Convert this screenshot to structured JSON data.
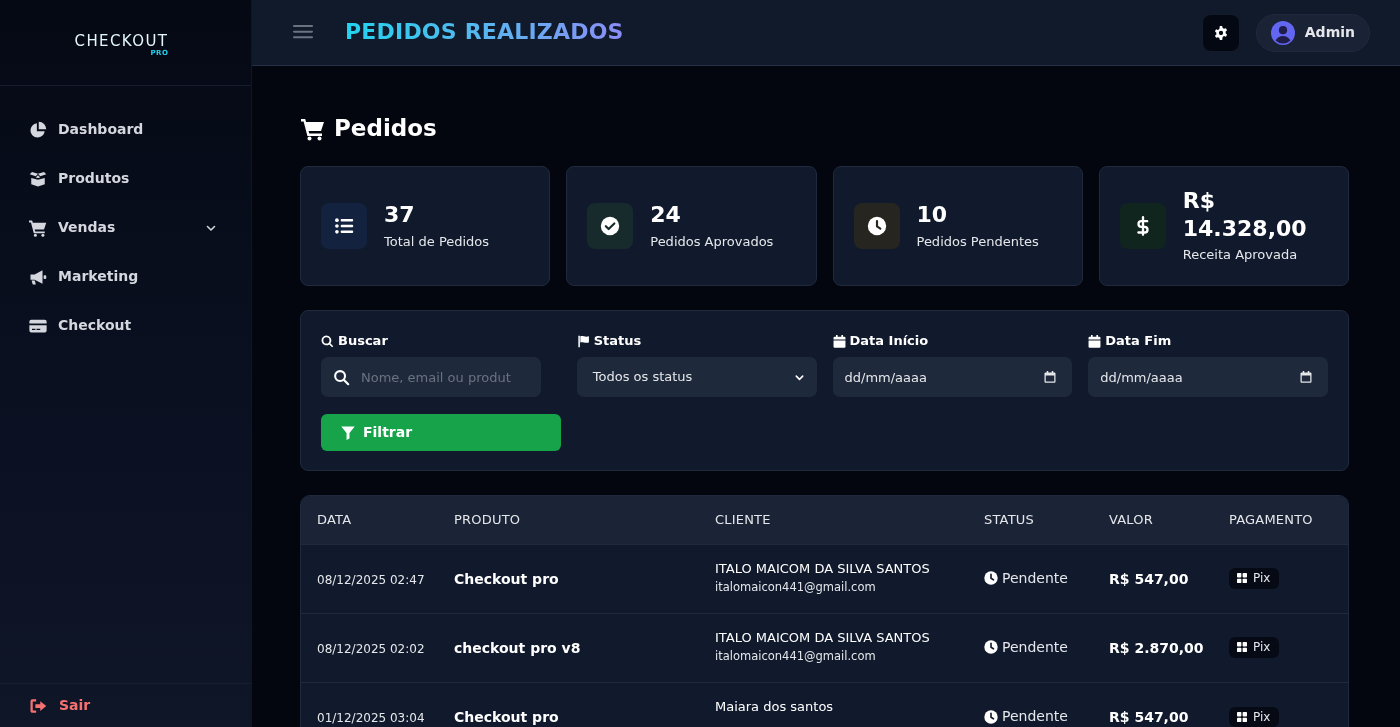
{
  "sidebar": {
    "logo": {
      "wordmark": "CHECKOUT",
      "tagline": "PRO"
    },
    "items": [
      {
        "label": "Dashboard",
        "kind": "link",
        "selected": false
      },
      {
        "label": "Produtos",
        "kind": "link",
        "selected": false
      },
      {
        "label": "Vendas",
        "kind": "group",
        "selected": false,
        "expanded": false
      },
      {
        "label": "Marketing",
        "kind": "link",
        "selected": false
      },
      {
        "label": "Checkout",
        "kind": "link",
        "selected": false
      }
    ],
    "logout": {
      "label": "Sair"
    }
  },
  "header": {
    "title": "PEDIDOS REALIZADOS",
    "user": {
      "name": "Admin"
    }
  },
  "page": {
    "title": "Pedidos"
  },
  "stats": [
    {
      "kind": "total",
      "value": "37",
      "label": "Total de Pedidos",
      "color": "#13233f"
    },
    {
      "kind": "approved",
      "value": "24",
      "label": "Pedidos Aprovados",
      "color": "#172a2c"
    },
    {
      "kind": "pending",
      "value": "10",
      "label": "Pedidos Pendentes",
      "color": "#26251f"
    },
    {
      "kind": "revenue",
      "value": "R$ 14.328,00",
      "label": "Receita Aprovada",
      "color": "#10251e"
    }
  ],
  "filters": {
    "fields": [
      {
        "kind": "search",
        "label": "Buscar",
        "placeholder": "Nome, email ou produt"
      },
      {
        "kind": "select",
        "label": "Status",
        "value": "Todos os status"
      },
      {
        "kind": "date",
        "label": "Data Início",
        "placeholder": "dd/mm/aaaa"
      },
      {
        "kind": "date",
        "label": "Data Fim",
        "placeholder": "dd/mm/aaaa"
      }
    ],
    "button": "Filtrar"
  },
  "table": {
    "columns": [
      "DATA",
      "PRODUTO",
      "CLIENTE",
      "STATUS",
      "VALOR",
      "PAGAMENTO"
    ],
    "rows": [
      {
        "date": "08/12/2025 02:47",
        "product": "Checkout pro",
        "client": "ITALO MAICOM DA SILVA SANTOS",
        "email": "italomaicon441@gmail.com",
        "status": "Pendente",
        "amount": "R$ 547,00",
        "payment": "Pix"
      },
      {
        "date": "08/12/2025 02:02",
        "product": "checkout pro v8",
        "client": "ITALO MAICOM DA SILVA SANTOS",
        "email": "italomaicon441@gmail.com",
        "status": "Pendente",
        "amount": "R$ 2.870,00",
        "payment": "Pix"
      },
      {
        "date": "01/12/2025 03:04",
        "product": "Checkout pro",
        "client": "Maiara dos santos",
        "status": "Pendente",
        "amount": "R$ 547,00",
        "payment": "Pix"
      }
    ]
  }
}
